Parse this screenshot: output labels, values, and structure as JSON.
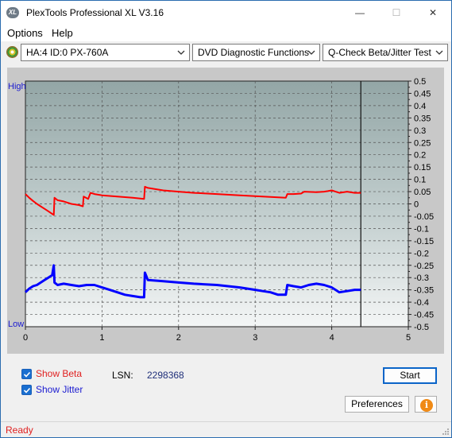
{
  "window": {
    "title": "PlexTools Professional XL V3.16",
    "logo_text": "XL",
    "minimize_glyph": "—",
    "maximize_glyph": "☐",
    "close_glyph": "✕"
  },
  "menu": {
    "options_label": "Options",
    "help_label": "Help"
  },
  "toolbar": {
    "drive": "HA:4 ID:0  PX-760A",
    "function": "DVD Diagnostic Functions",
    "test": "Q-Check Beta/Jitter Test"
  },
  "chart_data": {
    "type": "line",
    "left_axis_labels": {
      "top": "High",
      "bottom": "Low"
    },
    "x_ticks": [
      0,
      1,
      2,
      3,
      4,
      5
    ],
    "xlim": [
      0,
      5
    ],
    "y_ticks": [
      0.5,
      0.45,
      0.4,
      0.35,
      0.3,
      0.25,
      0.2,
      0.15,
      0.1,
      0.05,
      0,
      -0.05,
      -0.1,
      -0.15,
      -0.2,
      -0.25,
      -0.3,
      -0.35,
      -0.4,
      -0.45,
      -0.5
    ],
    "ylim": [
      -0.5,
      0.5
    ],
    "grid": true,
    "end_marker_x": 4.38,
    "series": [
      {
        "color": "#ff0000",
        "x": [
          0,
          0.05,
          0.1,
          0.15,
          0.2,
          0.25,
          0.3,
          0.37,
          0.38,
          0.42,
          0.5,
          0.6,
          0.7,
          0.75,
          0.76,
          0.82,
          0.85,
          0.9,
          1.0,
          1.2,
          1.4,
          1.55,
          1.56,
          1.6,
          1.8,
          2.0,
          2.2,
          2.5,
          2.8,
          3.1,
          3.4,
          3.42,
          3.5,
          3.6,
          3.64,
          3.8,
          3.9,
          3.95,
          4.0,
          4.05,
          4.1,
          4.2,
          4.3,
          4.38
        ],
        "y": [
          0.04,
          0.025,
          0.012,
          0.0,
          -0.01,
          -0.02,
          -0.03,
          -0.045,
          0.025,
          0.015,
          0.01,
          0.0,
          -0.005,
          -0.01,
          0.03,
          0.02,
          0.045,
          0.04,
          0.035,
          0.03,
          0.025,
          0.02,
          0.07,
          0.065,
          0.055,
          0.05,
          0.045,
          0.04,
          0.035,
          0.03,
          0.025,
          0.04,
          0.04,
          0.042,
          0.05,
          0.048,
          0.05,
          0.052,
          0.055,
          0.05,
          0.045,
          0.05,
          0.045,
          0.045
        ]
      },
      {
        "color": "#0000ff",
        "x": [
          0,
          0.05,
          0.1,
          0.15,
          0.2,
          0.25,
          0.3,
          0.35,
          0.37,
          0.38,
          0.42,
          0.5,
          0.6,
          0.7,
          0.8,
          0.9,
          1.0,
          1.1,
          1.2,
          1.3,
          1.4,
          1.5,
          1.55,
          1.56,
          1.6,
          1.8,
          2.0,
          2.2,
          2.5,
          2.8,
          3.0,
          3.1,
          3.2,
          3.3,
          3.4,
          3.42,
          3.5,
          3.6,
          3.7,
          3.8,
          3.9,
          4.0,
          4.05,
          4.1,
          4.2,
          4.3,
          4.38
        ],
        "y": [
          -0.36,
          -0.345,
          -0.335,
          -0.33,
          -0.32,
          -0.31,
          -0.3,
          -0.29,
          -0.25,
          -0.32,
          -0.33,
          -0.325,
          -0.33,
          -0.335,
          -0.33,
          -0.33,
          -0.34,
          -0.35,
          -0.36,
          -0.37,
          -0.375,
          -0.38,
          -0.38,
          -0.28,
          -0.31,
          -0.315,
          -0.32,
          -0.325,
          -0.33,
          -0.34,
          -0.35,
          -0.355,
          -0.36,
          -0.37,
          -0.37,
          -0.33,
          -0.335,
          -0.34,
          -0.33,
          -0.325,
          -0.33,
          -0.34,
          -0.35,
          -0.36,
          -0.355,
          -0.35,
          -0.35
        ]
      }
    ]
  },
  "options": {
    "show_beta_label": "Show Beta",
    "show_beta_checked": true,
    "show_jitter_label": "Show Jitter",
    "show_jitter_checked": true,
    "lsn_label": "LSN:",
    "lsn_value": "2298368"
  },
  "buttons": {
    "start_label": "Start",
    "preferences_label": "Preferences",
    "info_glyph": "i"
  },
  "status": {
    "text": "Ready"
  },
  "colors": {
    "beta": "#ff0000",
    "jitter": "#0000ff",
    "accent": "#0a64c8",
    "status_text": "#e02020"
  }
}
